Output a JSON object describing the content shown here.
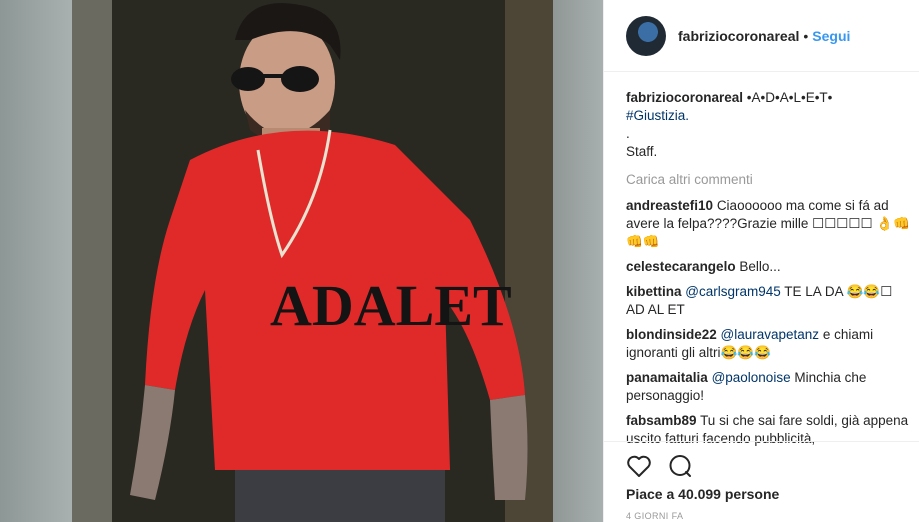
{
  "photo": {
    "shirt_text": "ADALET"
  },
  "header": {
    "username": "fabriziocoronareal",
    "separator": "•",
    "follow_label": "Segui"
  },
  "caption": {
    "username": "fabriziocoronareal",
    "text": "•A•D•A•L•E•T•",
    "hashtag": "#Giustizia.",
    "line2": ".",
    "line3": "Staff."
  },
  "load_more_label": "Carica altri commenti",
  "comments": [
    {
      "username": "andreastefi10",
      "mention": "",
      "text": "Ciaoooooo ma come si fá ad avere la felpa????Grazie mille ☐☐☐☐☐ 👌👊👊👊"
    },
    {
      "username": "celestecarangelo",
      "mention": "",
      "text": "Bello..."
    },
    {
      "username": "kibettina",
      "mention": "@carlsgram945",
      "text": "TE LA DA 😂😂☐ AD AL ET"
    },
    {
      "username": "blondinside22",
      "mention": "@lauravapetanz",
      "text": "e chiami ignoranti gli altri😂😂😂"
    },
    {
      "username": "panamaitalia",
      "mention": "@paolonoise",
      "text": "Minchia che personaggio!"
    },
    {
      "username": "fabsamb89",
      "mention": "",
      "text": "Tu si che sai fare soldi, già appena uscito fatturi facendo pubblicità,"
    }
  ],
  "actions": {
    "like_icon": "heart-icon",
    "comment_icon": "comment-icon"
  },
  "likes_text": "Piace a 40.099 persone",
  "timestamp": "4 GIORNI FA",
  "colors": {
    "link": "#003569",
    "follow": "#3897f0",
    "sweater": "#e02a2a"
  }
}
